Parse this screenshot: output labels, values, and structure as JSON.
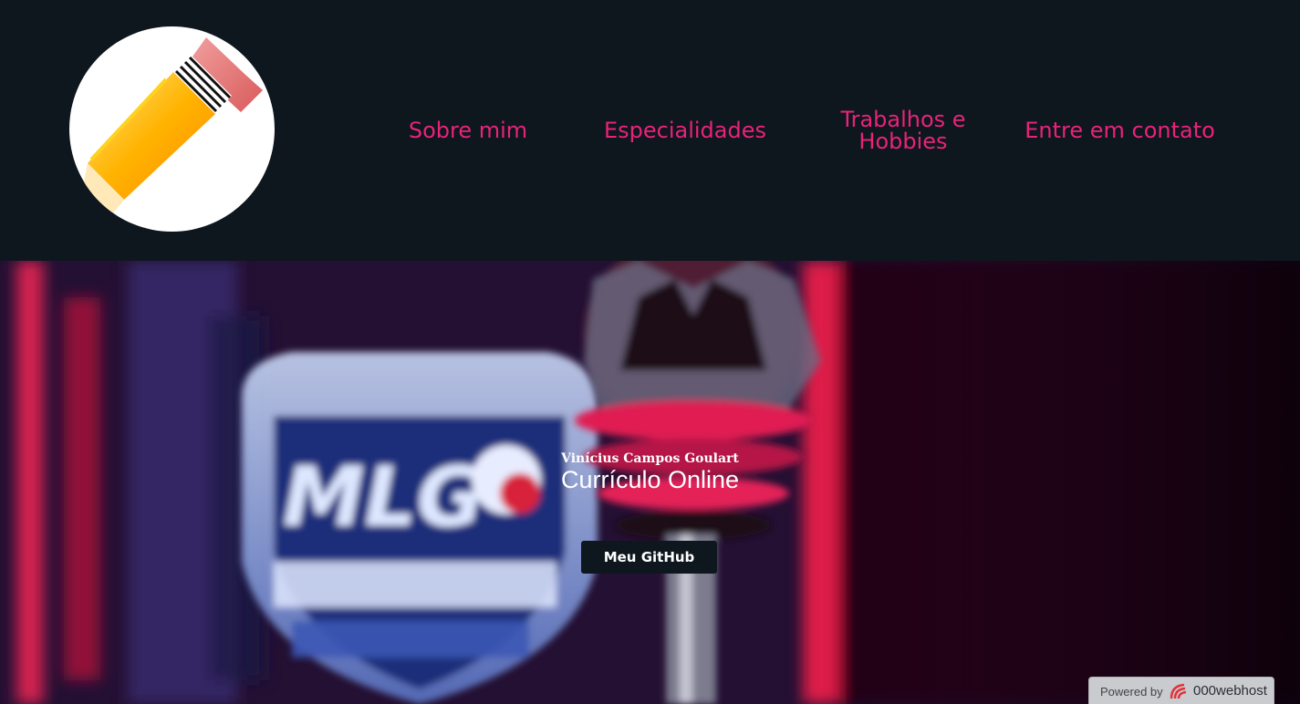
{
  "nav": {
    "items": [
      {
        "label": "Sobre mim"
      },
      {
        "label": "Especialidades"
      },
      {
        "label": "Trabalhos e Hobbies"
      },
      {
        "label": "Entre em contato"
      }
    ]
  },
  "logo": {
    "icon": "pencil-icon"
  },
  "hero": {
    "name": "Vinícius Campos Goulart",
    "title": "Currículo Online",
    "button_label": "Meu GitHub",
    "background": "blurred esports trophy image"
  },
  "badge": {
    "powered_by": "Powered by",
    "brand": "000webhost",
    "icon": "000webhost-logo-icon"
  },
  "colors": {
    "header_bg": "#0e161e",
    "nav_link": "#e8237a",
    "button_bg": "#0e161e"
  }
}
